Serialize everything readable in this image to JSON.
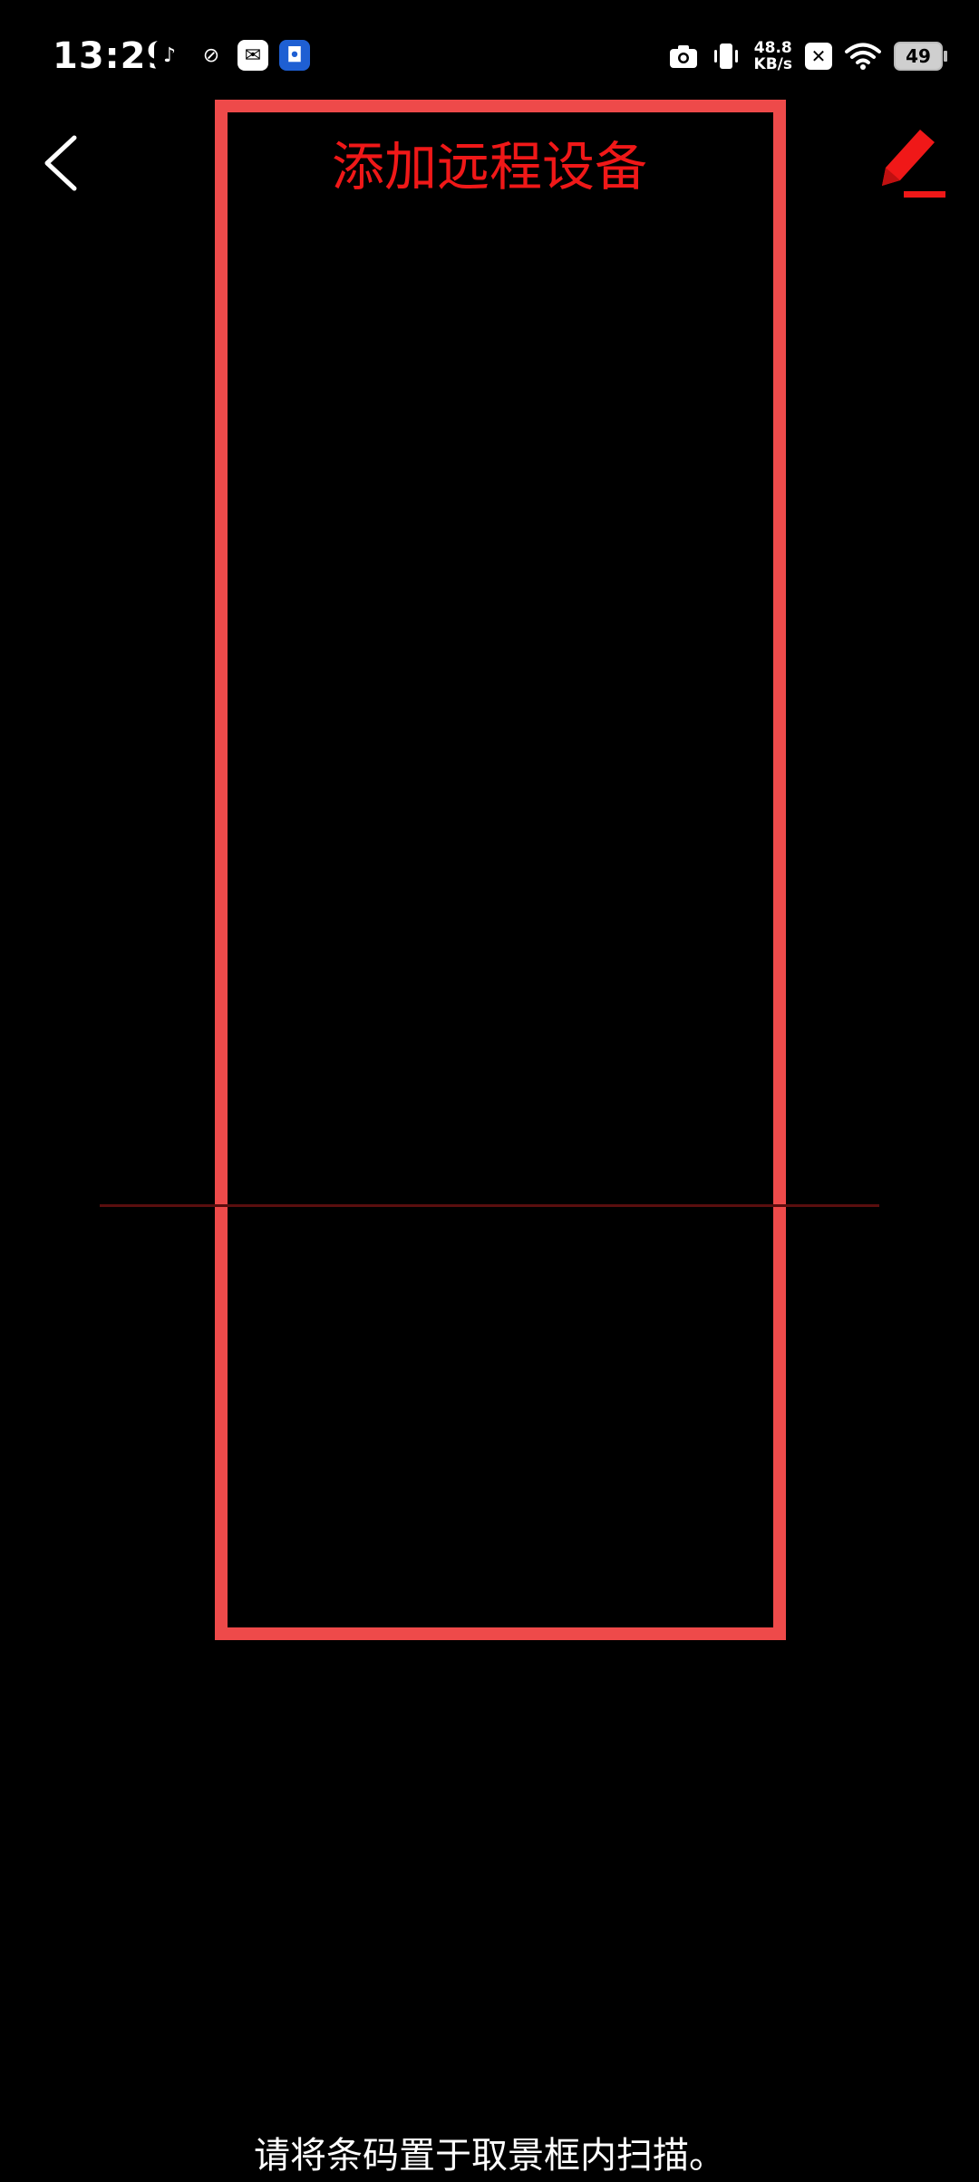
{
  "status_bar": {
    "time": "13:29",
    "net_speed_value": "48.8",
    "net_speed_unit": "KB/s",
    "battery": "49",
    "notification_icons": [
      "tiktok-icon",
      "orbit-app-icon",
      "mail-icon",
      "blue-app-icon"
    ],
    "system_icons": [
      "camera-icon",
      "vibrate-icon",
      "no-sim-icon",
      "wifi-icon",
      "battery-icon"
    ]
  },
  "header": {
    "title": "添加远程设备",
    "back_icon": "chevron-left-icon",
    "edit_icon": "pencil-icon"
  },
  "scanner": {
    "hint": "请将条码置于取景框内扫描。"
  },
  "colors": {
    "accent": "#f01818",
    "frame": "#ee4a4a",
    "scan_line": "#5a0e0e",
    "background": "#000000"
  }
}
